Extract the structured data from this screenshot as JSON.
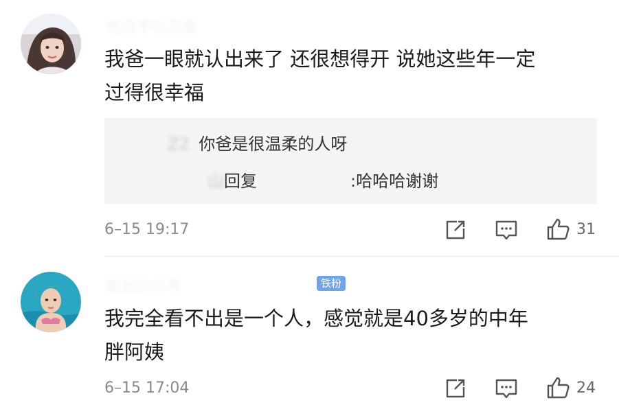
{
  "comments": [
    {
      "avatar_icon": "avatar-woman-photo",
      "username": "吃瓜不吐瓜皮",
      "text_line1": "我爸一眼就认出来了 还很想得开 说她这些年一定",
      "text_line2": "过得很幸福",
      "replies": [
        {
          "username": "Z2",
          "text": "你爸是很温柔的人呀"
        },
        {
          "username": "山",
          "reply_keyword": "回复",
          "reply_to": "",
          "text": ":哈哈哈谢谢"
        }
      ],
      "time": "6–15 19:17",
      "like_count": "31"
    },
    {
      "avatar_icon": "avatar-swimmer-photo",
      "username": "粉丝的小号",
      "badge": "铁粉",
      "text_line1": "我完全看不出是一个人，感觉就是40多岁的中年",
      "text_line2": "胖阿姨",
      "time": "6–15 17:04",
      "like_count": "24"
    }
  ],
  "colors": {
    "badge": "#6fa5e8",
    "reply_bg": "#f4f4f6",
    "meta_text": "#8a8a8a"
  }
}
